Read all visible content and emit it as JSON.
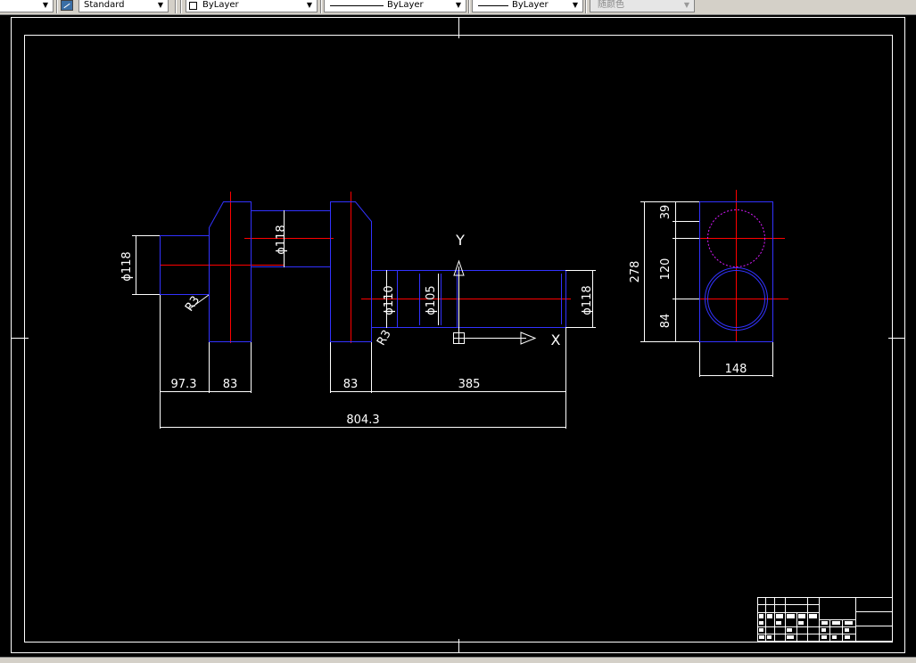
{
  "toolbar": {
    "text_style": "Standard",
    "layer": "ByLayer",
    "linetype": "ByLayer",
    "lineweight": "ByLayer",
    "plot_style": "随颜色"
  },
  "drawing": {
    "dimensions": {
      "dia_118_left": "ϕ118",
      "radius_r3_left": "R3",
      "dia_118_pin": "ϕ118",
      "radius_r3_right": "R3",
      "dia_110": "ϕ110",
      "dia_105": "ϕ105",
      "dia_118_right": "ϕ118",
      "len_97_3": "97.3",
      "len_83_a": "83",
      "len_83_b": "83",
      "len_385": "385",
      "len_804_3": "804.3",
      "side_39": "39",
      "side_278": "278",
      "side_120": "120",
      "side_84": "84",
      "side_148": "148"
    },
    "ucs": {
      "y_label": "Y",
      "x_label": "X"
    }
  }
}
